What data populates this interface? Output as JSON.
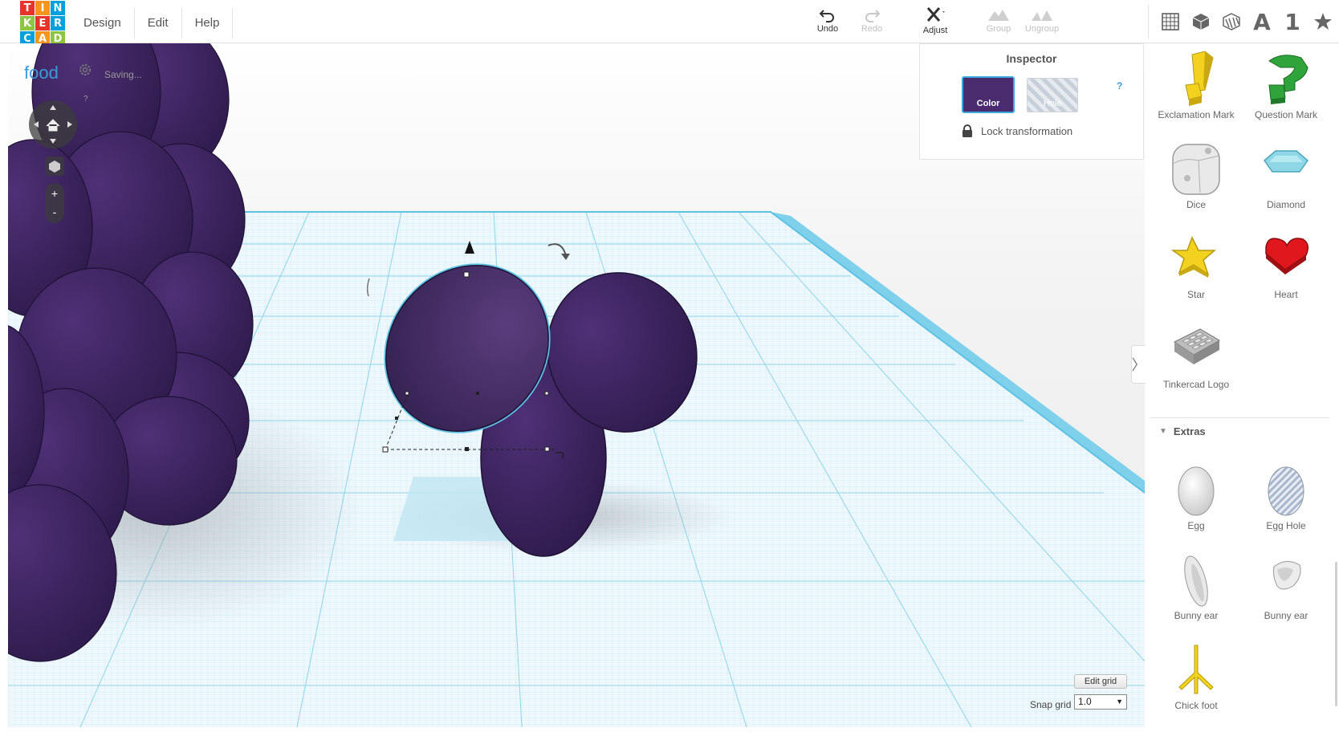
{
  "app": {
    "logo_letters": [
      "T",
      "I",
      "N",
      "K",
      "E",
      "R",
      "C",
      "A",
      "D"
    ],
    "logo_colors": [
      "#e6342a",
      "#f7941d",
      "#00a0dc",
      "#8cc63f",
      "#e6342a",
      "#00a0dc",
      "#00a0dc",
      "#f7941d",
      "#8cc63f"
    ]
  },
  "menu": {
    "items": [
      "Design",
      "Edit",
      "Help"
    ]
  },
  "toolbar": {
    "undo_label": "Undo",
    "redo_label": "Redo",
    "adjust_label": "Adjust",
    "group_label": "Group",
    "ungroup_label": "Ungroup"
  },
  "shape_categories": {
    "letters": "A",
    "numbers": "1"
  },
  "design": {
    "name": "food",
    "status": "Saving...",
    "help": "?"
  },
  "inspector": {
    "title": "Inspector",
    "color_label": "Color",
    "hole_label": "Hole",
    "help": "?",
    "lock_label": "Lock transformation",
    "current_color": "#4a2c6e"
  },
  "grid": {
    "edit_label": "Edit grid",
    "snap_label": "Snap grid",
    "snap_value": "1.0"
  },
  "shapes": {
    "items": [
      {
        "label": "Exclamation Mark"
      },
      {
        "label": "Question Mark"
      },
      {
        "label": "Dice"
      },
      {
        "label": "Diamond"
      },
      {
        "label": "Star"
      },
      {
        "label": "Heart"
      },
      {
        "label": "Tinkercad Logo"
      }
    ],
    "extras_title": "Extras",
    "extras": [
      {
        "label": "Egg"
      },
      {
        "label": "Egg Hole"
      },
      {
        "label": "Bunny ear"
      },
      {
        "label": "Bunny ear"
      },
      {
        "label": "Chick foot"
      }
    ]
  },
  "colors": {
    "accent": "#3a9bd9",
    "grape": "#3d2460",
    "grid": "#9fdcef"
  }
}
